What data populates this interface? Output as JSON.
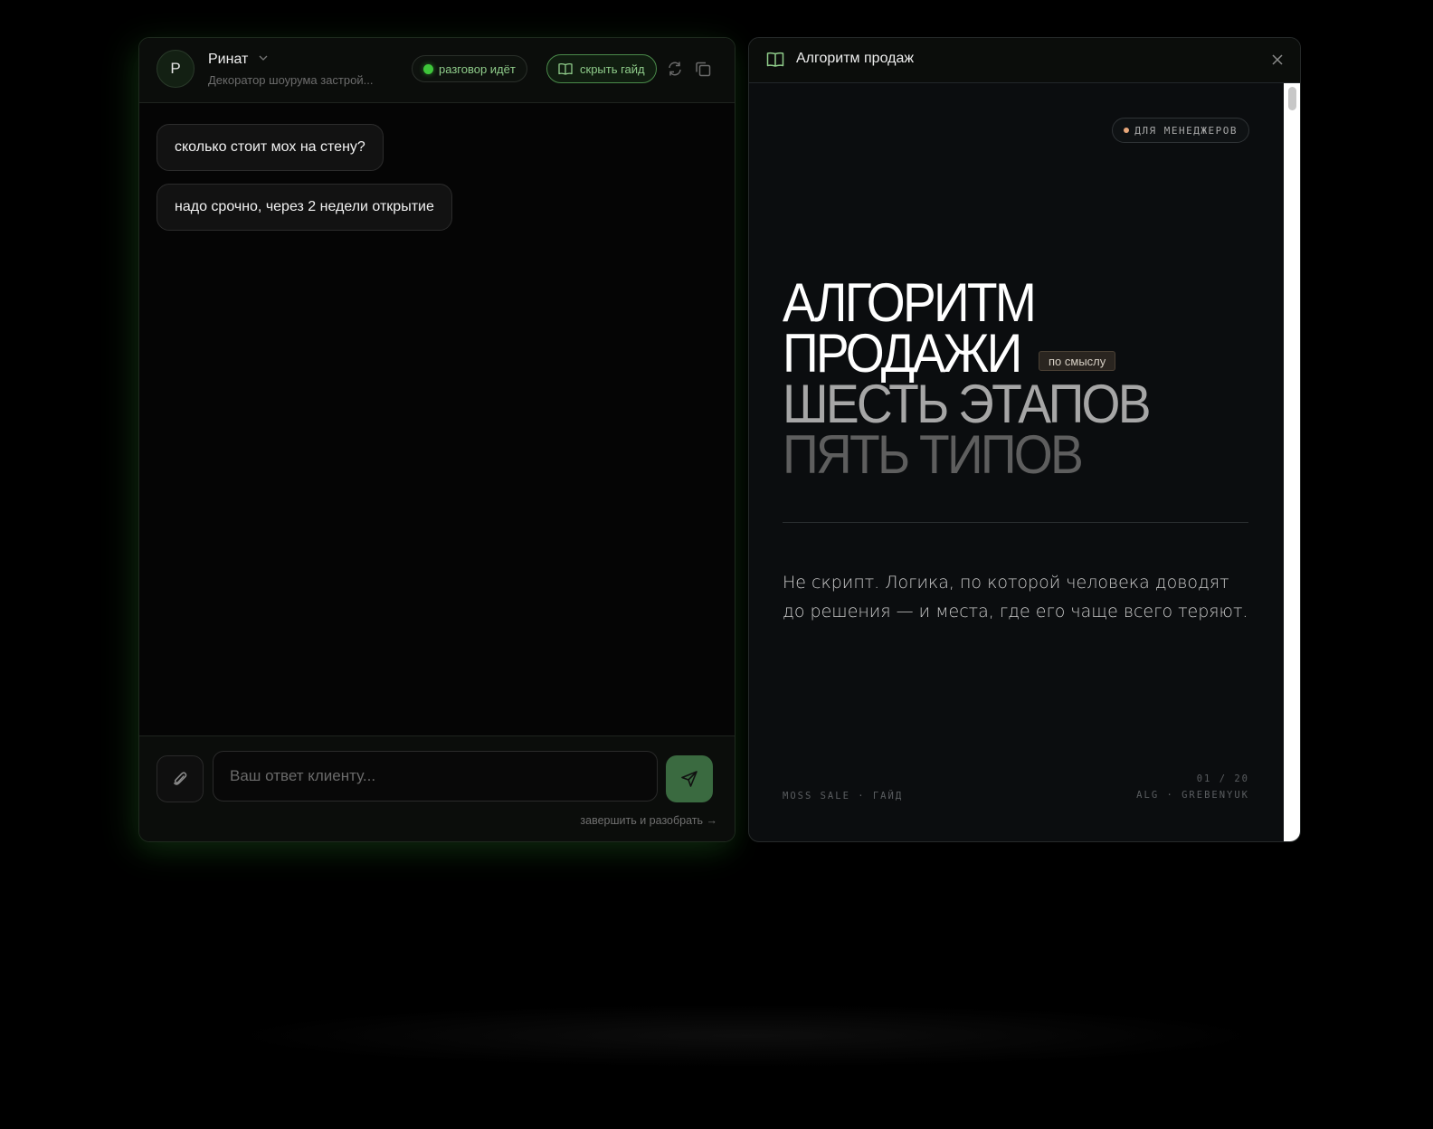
{
  "colors": {
    "accent_green": "#3ec53a",
    "accent_green_text": "#8fcc8a",
    "send_button": "#3a6a40",
    "badge_dot": "#e8a77a"
  },
  "chat": {
    "avatar_initial": "Р",
    "client_name": "Ринат",
    "client_subtitle": "Декоратор шоурума застрой...",
    "status_label": "разговор идёт",
    "guide_toggle_label": "скрыть гайд",
    "icons": {
      "name_menu": "chevron-down-icon",
      "guide_toggle": "book-icon",
      "refresh": "refresh-icon",
      "copy": "copy-icon",
      "attach": "paperclip-icon",
      "send": "send-icon"
    },
    "messages": [
      {
        "text": "сколько стоит мох на стену?"
      },
      {
        "text": "надо срочно, через 2 недели открытие"
      }
    ],
    "composer": {
      "placeholder": "Ваш ответ клиенту...",
      "value": "",
      "finish_label": "завершить и разобрать →"
    }
  },
  "guide": {
    "panel_title": "Алгоритм продаж",
    "icons": {
      "title": "book-icon",
      "close": "close-icon"
    },
    "audience_badge": "ДЛЯ МЕНЕДЖЕРОВ",
    "hero": {
      "line1": "АЛГОРИТМ",
      "line2": "ПРОДАЖИ",
      "tag": "по смыслу",
      "line3": "ШЕСТЬ ЭТАПОВ",
      "line4": "ПЯТЬ ТИПОВ"
    },
    "lead_text": "Не скрипт. Логика, по которой человека доводят до решения — и места, где его чаще всего теряют.",
    "footer_left": "MOSS SALE · ГАЙД",
    "page_indicator": "01 / 20",
    "footer_right": "ALG · GREBENYUK"
  }
}
